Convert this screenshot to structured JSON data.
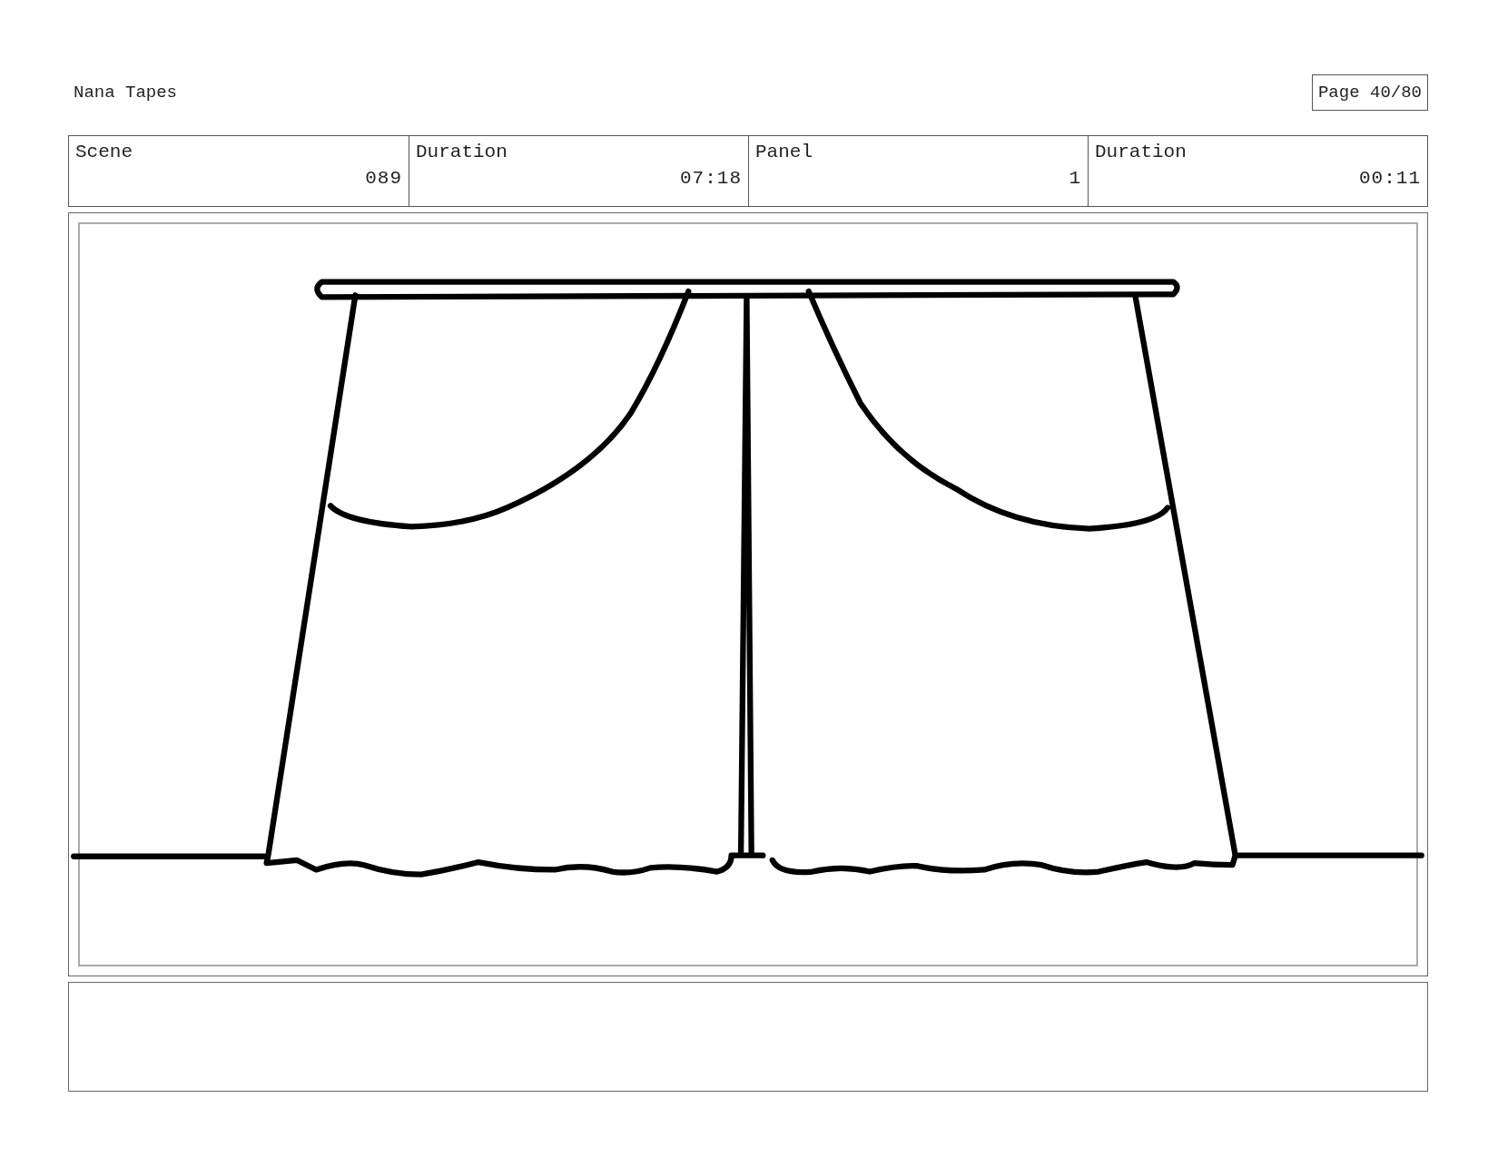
{
  "header": {
    "title": "Nana Tapes",
    "page": "Page 40/80"
  },
  "info_table": {
    "columns": [
      "Scene",
      "Duration",
      "Panel",
      "Duration"
    ],
    "row": [
      "089",
      "07:18",
      "1",
      "00:11"
    ]
  }
}
